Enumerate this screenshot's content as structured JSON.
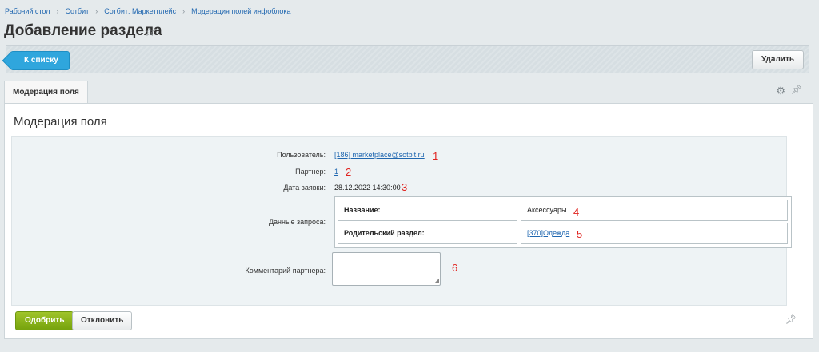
{
  "breadcrumb": [
    "Рабочий стол",
    "Сотбит",
    "Сотбит: Маркетплейс",
    "Модерация полей инфоблока"
  ],
  "page": {
    "title": "Добавление раздела"
  },
  "toolbar": {
    "back_label": "К списку",
    "delete_label": "Удалить"
  },
  "tabs": [
    {
      "label": "Модерация поля"
    }
  ],
  "panel": {
    "title": "Модерация поля"
  },
  "form": {
    "user": {
      "label": "Пользователь:",
      "value": "[186] marketplace@sotbit.ru",
      "annotation": "1"
    },
    "partner": {
      "label": "Партнер:",
      "value": "1",
      "annotation": "2"
    },
    "date": {
      "label": "Дата заявки:",
      "value": "28.12.2022 14:30:00",
      "annotation": "3"
    },
    "request": {
      "label": "Данные запроса:",
      "rows": [
        {
          "key": "Название:",
          "value": "Аксессуары",
          "annotation": "4"
        },
        {
          "key": "Родительский раздел:",
          "value": "[370]Одежда",
          "annotation": "5"
        }
      ]
    },
    "comment": {
      "label": "Комментарий партнера:",
      "value": "",
      "annotation": "6"
    }
  },
  "actions": {
    "approve_label": "Одобрить",
    "reject_label": "Отклонить"
  },
  "icons": {
    "star": "star-icon",
    "settings": "gear-icon",
    "pin": "pin-icon"
  },
  "colors": {
    "back_button": "#2fa6dd",
    "approve_button": "#8db51b",
    "annotation": "#e0231f",
    "link": "#2067b0"
  }
}
